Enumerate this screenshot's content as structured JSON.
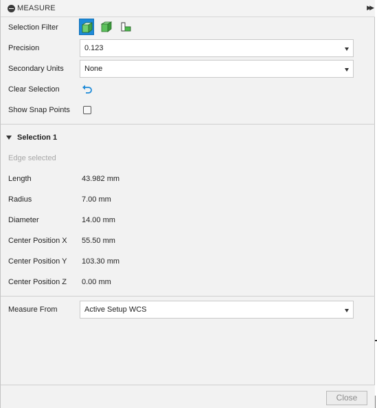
{
  "titlebar": {
    "title": "MEASURE",
    "collapse_icon": "minus-circle-icon",
    "expand_icon": "double-chevron-right-icon"
  },
  "selection_filter": {
    "label": "Selection Filter",
    "buttons": [
      {
        "icon": "select-body-icon",
        "active": true
      },
      {
        "icon": "select-face-icon",
        "active": false
      },
      {
        "icon": "select-edge-icon",
        "active": false
      }
    ],
    "accent": "#1c8ad8"
  },
  "precision": {
    "label": "Precision",
    "value": "0.123"
  },
  "secondary_units": {
    "label": "Secondary Units",
    "value": "None"
  },
  "clear_selection": {
    "label": "Clear Selection",
    "icon": "undo-arrow-icon"
  },
  "show_snap_points": {
    "label": "Show Snap Points",
    "checked": false
  },
  "selection_group": {
    "title": "Selection 1",
    "status": "Edge selected",
    "rows": [
      {
        "label": "Length",
        "value": "43.982 mm"
      },
      {
        "label": "Radius",
        "value": "7.00 mm"
      },
      {
        "label": "Diameter",
        "value": "14.00 mm"
      },
      {
        "label": "Center Position X",
        "value": "55.50 mm"
      },
      {
        "label": "Center Position Y",
        "value": "103.30 mm"
      },
      {
        "label": "Center Position Z",
        "value": "0.00 mm"
      }
    ]
  },
  "measure_from": {
    "label": "Measure From",
    "value": "Active Setup WCS"
  },
  "footer": {
    "close_label": "Close"
  }
}
